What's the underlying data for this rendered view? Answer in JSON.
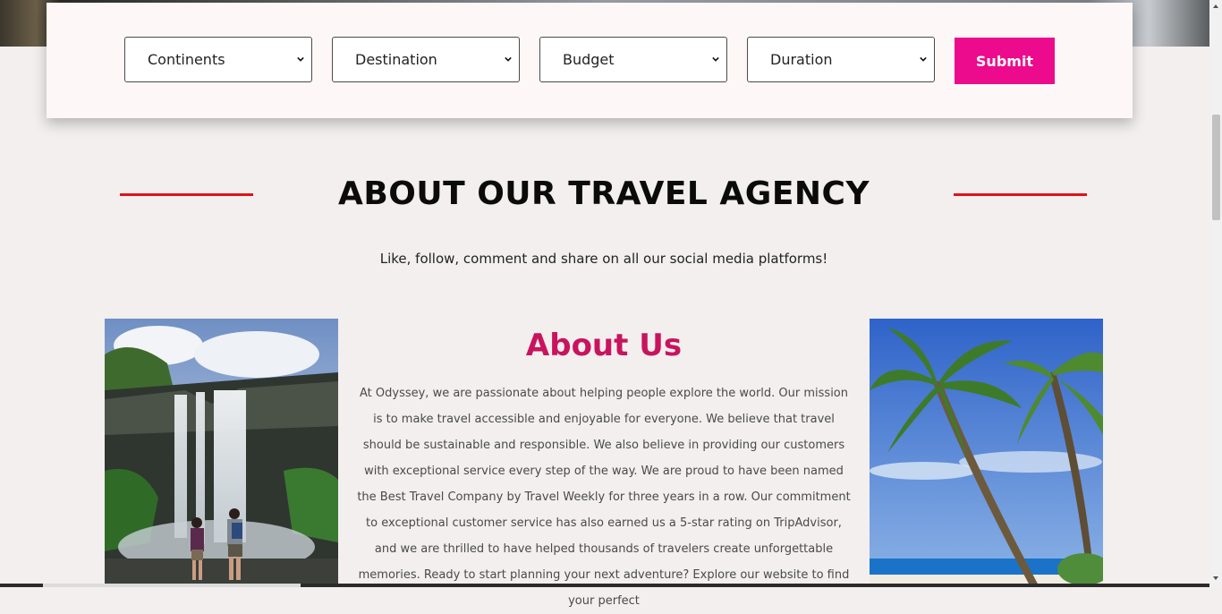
{
  "search": {
    "filters": [
      {
        "label": "Continents"
      },
      {
        "label": "Destination"
      },
      {
        "label": "Budget"
      },
      {
        "label": "Duration"
      }
    ],
    "submit_label": "Submit"
  },
  "about_section": {
    "title": "ABOUT OUR TRAVEL AGENCY",
    "subtitle": "Like, follow, comment and share on all our social media platforms!",
    "heading": "About Us",
    "body": "At Odyssey, we are passionate about helping people explore the world. Our mission is to make travel accessible and enjoyable for everyone. We believe that travel should be sustainable and responsible. We also believe in providing our customers with exceptional service every step of the way. We are proud to have been named the Best Travel Company by Travel Weekly for three years in a row. Our commitment to exceptional customer service has also earned us a 5-star rating on TripAdvisor, and we are thrilled to have helped thousands of travelers create unforgettable memories. Ready to start planning your next adventure? Explore our website to find your perfect"
  },
  "colors": {
    "accent": "#ec0b8d",
    "heading": "#c8145e",
    "divider": "#e0131a",
    "background": "#f2efee"
  },
  "icons": {
    "select_arrow": "chevron-down-icon"
  }
}
